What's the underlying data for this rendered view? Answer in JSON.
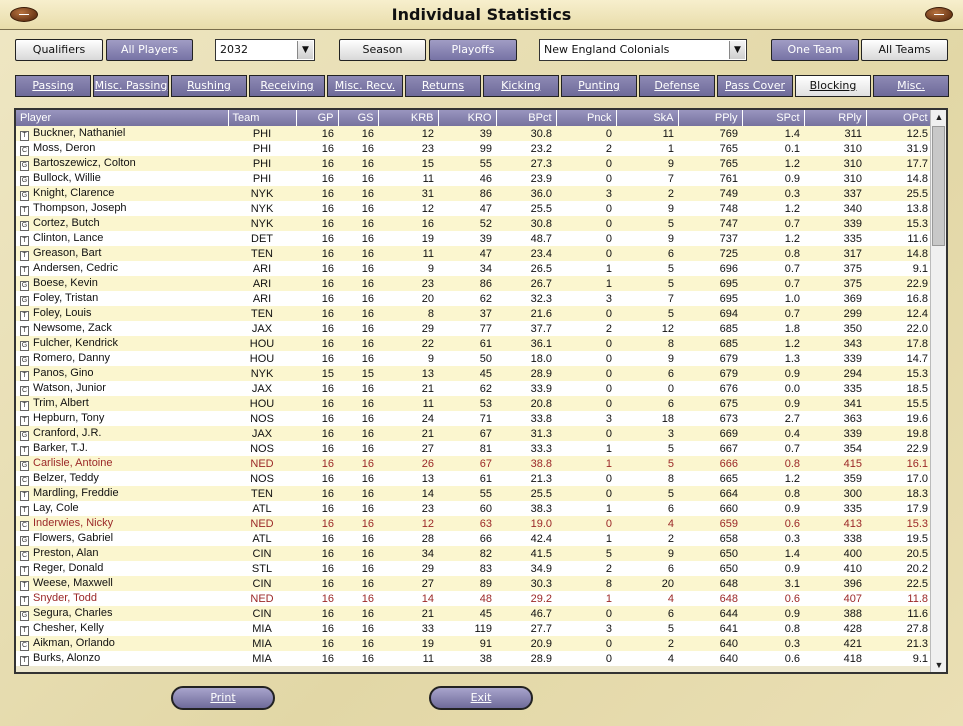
{
  "window": {
    "title": "Individual Statistics"
  },
  "toolbar": {
    "qualifiers": "Qualifiers",
    "all_players": "All Players",
    "year": "2032",
    "season": "Season",
    "playoffs": "Playoffs",
    "team_select": "New England Colonials",
    "one_team": "One Team",
    "all_teams": "All Teams"
  },
  "tabs": [
    "Passing",
    "Misc. Passing",
    "Rushing",
    "Receiving",
    "Misc. Recv.",
    "Returns",
    "Kicking",
    "Punting",
    "Defense",
    "Pass Cover",
    "Blocking",
    "Misc."
  ],
  "active_tab": "Blocking",
  "table": {
    "columns": [
      "Player",
      "Team",
      "GP",
      "GS",
      "KRB",
      "KRO",
      "BPct",
      "Pnck",
      "SkA",
      "PPly",
      "SPct",
      "RPly",
      "OPct"
    ],
    "rows": [
      [
        "T",
        "Buckner, Nathaniel",
        "PHI",
        "16",
        "16",
        "12",
        "39",
        "30.8",
        "0",
        "11",
        "769",
        "1.4",
        "311",
        "12.5"
      ],
      [
        "C",
        "Moss, Deron",
        "PHI",
        "16",
        "16",
        "23",
        "99",
        "23.2",
        "2",
        "1",
        "765",
        "0.1",
        "310",
        "31.9"
      ],
      [
        "G",
        "Bartoszewicz, Colton",
        "PHI",
        "16",
        "16",
        "15",
        "55",
        "27.3",
        "0",
        "9",
        "765",
        "1.2",
        "310",
        "17.7"
      ],
      [
        "G",
        "Bullock, Willie",
        "PHI",
        "16",
        "16",
        "11",
        "46",
        "23.9",
        "0",
        "7",
        "761",
        "0.9",
        "310",
        "14.8"
      ],
      [
        "G",
        "Knight, Clarence",
        "NYK",
        "16",
        "16",
        "31",
        "86",
        "36.0",
        "3",
        "2",
        "749",
        "0.3",
        "337",
        "25.5"
      ],
      [
        "T",
        "Thompson, Joseph",
        "NYK",
        "16",
        "16",
        "12",
        "47",
        "25.5",
        "0",
        "9",
        "748",
        "1.2",
        "340",
        "13.8"
      ],
      [
        "G",
        "Cortez, Butch",
        "NYK",
        "16",
        "16",
        "16",
        "52",
        "30.8",
        "0",
        "5",
        "747",
        "0.7",
        "339",
        "15.3"
      ],
      [
        "T",
        "Clinton, Lance",
        "DET",
        "16",
        "16",
        "19",
        "39",
        "48.7",
        "0",
        "9",
        "737",
        "1.2",
        "335",
        "11.6"
      ],
      [
        "T",
        "Greason, Bart",
        "TEN",
        "16",
        "16",
        "11",
        "47",
        "23.4",
        "0",
        "6",
        "725",
        "0.8",
        "317",
        "14.8"
      ],
      [
        "T",
        "Andersen, Cedric",
        "ARI",
        "16",
        "16",
        "9",
        "34",
        "26.5",
        "1",
        "5",
        "696",
        "0.7",
        "375",
        "9.1"
      ],
      [
        "G",
        "Boese, Kevin",
        "ARI",
        "16",
        "16",
        "23",
        "86",
        "26.7",
        "1",
        "5",
        "695",
        "0.7",
        "375",
        "22.9"
      ],
      [
        "G",
        "Foley, Tristan",
        "ARI",
        "16",
        "16",
        "20",
        "62",
        "32.3",
        "3",
        "7",
        "695",
        "1.0",
        "369",
        "16.8"
      ],
      [
        "T",
        "Foley, Louis",
        "TEN",
        "16",
        "16",
        "8",
        "37",
        "21.6",
        "0",
        "5",
        "694",
        "0.7",
        "299",
        "12.4"
      ],
      [
        "T",
        "Newsome, Zack",
        "JAX",
        "16",
        "16",
        "29",
        "77",
        "37.7",
        "2",
        "12",
        "685",
        "1.8",
        "350",
        "22.0"
      ],
      [
        "G",
        "Fulcher, Kendrick",
        "HOU",
        "16",
        "16",
        "22",
        "61",
        "36.1",
        "0",
        "8",
        "685",
        "1.2",
        "343",
        "17.8"
      ],
      [
        "G",
        "Romero, Danny",
        "HOU",
        "16",
        "16",
        "9",
        "50",
        "18.0",
        "0",
        "9",
        "679",
        "1.3",
        "339",
        "14.7"
      ],
      [
        "T",
        "Panos, Gino",
        "NYK",
        "15",
        "15",
        "13",
        "45",
        "28.9",
        "0",
        "6",
        "679",
        "0.9",
        "294",
        "15.3"
      ],
      [
        "C",
        "Watson, Junior",
        "JAX",
        "16",
        "16",
        "21",
        "62",
        "33.9",
        "0",
        "0",
        "676",
        "0.0",
        "335",
        "18.5"
      ],
      [
        "T",
        "Trim, Albert",
        "HOU",
        "16",
        "16",
        "11",
        "53",
        "20.8",
        "0",
        "6",
        "675",
        "0.9",
        "341",
        "15.5"
      ],
      [
        "T",
        "Hepburn, Tony",
        "NOS",
        "16",
        "16",
        "24",
        "71",
        "33.8",
        "3",
        "18",
        "673",
        "2.7",
        "363",
        "19.6"
      ],
      [
        "G",
        "Cranford, J.R.",
        "JAX",
        "16",
        "16",
        "21",
        "67",
        "31.3",
        "0",
        "3",
        "669",
        "0.4",
        "339",
        "19.8"
      ],
      [
        "T",
        "Barker, T.J.",
        "NOS",
        "16",
        "16",
        "27",
        "81",
        "33.3",
        "1",
        "5",
        "667",
        "0.7",
        "354",
        "22.9"
      ],
      [
        "G",
        "Carlisle, Antoine",
        "NED",
        "16",
        "16",
        "26",
        "67",
        "38.8",
        "1",
        "5",
        "666",
        "0.8",
        "415",
        "16.1"
      ],
      [
        "C",
        "Belzer, Teddy",
        "NOS",
        "16",
        "16",
        "13",
        "61",
        "21.3",
        "0",
        "8",
        "665",
        "1.2",
        "359",
        "17.0"
      ],
      [
        "T",
        "Mardling, Freddie",
        "TEN",
        "16",
        "16",
        "14",
        "55",
        "25.5",
        "0",
        "5",
        "664",
        "0.8",
        "300",
        "18.3"
      ],
      [
        "T",
        "Lay, Cole",
        "ATL",
        "16",
        "16",
        "23",
        "60",
        "38.3",
        "1",
        "6",
        "660",
        "0.9",
        "335",
        "17.9"
      ],
      [
        "C",
        "Inderwies, Nicky",
        "NED",
        "16",
        "16",
        "12",
        "63",
        "19.0",
        "0",
        "4",
        "659",
        "0.6",
        "413",
        "15.3"
      ],
      [
        "G",
        "Flowers, Gabriel",
        "ATL",
        "16",
        "16",
        "28",
        "66",
        "42.4",
        "1",
        "2",
        "658",
        "0.3",
        "338",
        "19.5"
      ],
      [
        "C",
        "Preston, Alan",
        "CIN",
        "16",
        "16",
        "34",
        "82",
        "41.5",
        "5",
        "9",
        "650",
        "1.4",
        "400",
        "20.5"
      ],
      [
        "T",
        "Reger, Donald",
        "STL",
        "16",
        "16",
        "29",
        "83",
        "34.9",
        "2",
        "6",
        "650",
        "0.9",
        "410",
        "20.2"
      ],
      [
        "T",
        "Weese, Maxwell",
        "CIN",
        "16",
        "16",
        "27",
        "89",
        "30.3",
        "8",
        "20",
        "648",
        "3.1",
        "396",
        "22.5"
      ],
      [
        "T",
        "Snyder, Todd",
        "NED",
        "16",
        "16",
        "14",
        "48",
        "29.2",
        "1",
        "4",
        "648",
        "0.6",
        "407",
        "11.8"
      ],
      [
        "G",
        "Segura, Charles",
        "CIN",
        "16",
        "16",
        "21",
        "45",
        "46.7",
        "0",
        "6",
        "644",
        "0.9",
        "388",
        "11.6"
      ],
      [
        "T",
        "Chesher, Kelly",
        "MIA",
        "16",
        "16",
        "33",
        "119",
        "27.7",
        "3",
        "5",
        "641",
        "0.8",
        "428",
        "27.8"
      ],
      [
        "C",
        "Aikman, Orlando",
        "MIA",
        "16",
        "16",
        "19",
        "91",
        "20.9",
        "0",
        "2",
        "640",
        "0.3",
        "421",
        "21.3"
      ],
      [
        "T",
        "Burks, Alonzo",
        "MIA",
        "16",
        "16",
        "11",
        "38",
        "28.9",
        "0",
        "4",
        "640",
        "0.6",
        "418",
        "9.1"
      ]
    ],
    "highlight_team": "NED"
  },
  "footer": {
    "print": "Print",
    "exit": "Exit"
  },
  "icons": {
    "scroll_up": "chevron-up-icon",
    "scroll_down": "chevron-down-icon",
    "dropdown": "chevron-down-icon"
  },
  "colors": {
    "tab_bg": "#7f7ba9",
    "row_odd": "#fbf6cf",
    "row_even": "#ffffff",
    "highlight_text": "#9b2828",
    "header_bg": "#8783b0"
  }
}
